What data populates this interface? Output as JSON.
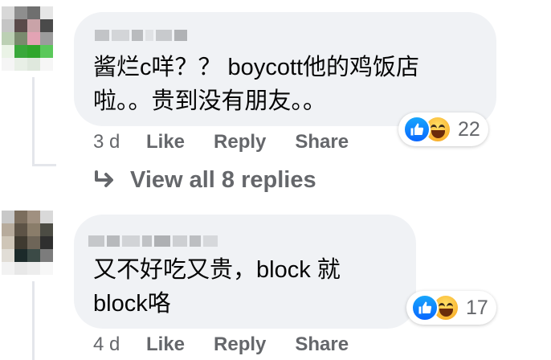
{
  "comments": [
    {
      "text_line1": "酱烂c咩？？ boycott他的鸡饭店",
      "text_line2": "啦。。贵到没有朋友。。",
      "reaction_count": "22",
      "time": "3 d",
      "like_label": "Like",
      "reply_label": "Reply",
      "share_label": "Share",
      "view_replies_label": "View all 8 replies"
    },
    {
      "text_line1": "又不好吃又贵，block 就",
      "text_line2": "block咯",
      "reaction_count": "17",
      "time": "4 d",
      "like_label": "Like",
      "reply_label": "Reply",
      "share_label": "Share"
    }
  ],
  "icons": {
    "like": "like-reaction-icon",
    "haha": "haha-reaction-icon",
    "reply_arrow": "reply-arrow-icon"
  },
  "colors": {
    "like_blue": "#0866ff",
    "meta_gray": "#65676b",
    "bubble_bg": "#f0f2f5"
  }
}
